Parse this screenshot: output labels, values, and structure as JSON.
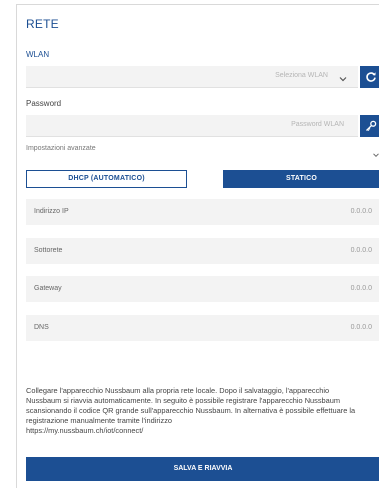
{
  "title": "RETE",
  "wlan": {
    "label": "WLAN",
    "placeholder": "Seleziona WLAN"
  },
  "password": {
    "label": "Password",
    "placeholder": "Password WLAN"
  },
  "advanced": {
    "label": "Impostazioni avanzate"
  },
  "mode": {
    "dhcp_label": "DHCP (AUTOMATICO)",
    "static_label": "STATICO",
    "selected": "STATICO"
  },
  "fields": [
    {
      "label": "Indirizzo IP",
      "value": "0.0.0.0"
    },
    {
      "label": "Sottorete",
      "value": "0.0.0.0"
    },
    {
      "label": "Gateway",
      "value": "0.0.0.0"
    },
    {
      "label": "DNS",
      "value": "0.0.0.0"
    }
  ],
  "info_lines": [
    "Collegare l'apparecchio Nussbaum alla propria rete locale. Dopo il salvataggio, l'apparecchio",
    "Nussbaum si riavvia automaticamente. In seguito è possibile registrare l'apparecchio Nussbaum",
    "scansionando il codice QR grande sull'apparecchio Nussbaum. In alternativa è possibile effettuare la",
    "registrazione manualmente tramite l'indirizzo",
    "https://my.nussbaum.ch/iot/connect/"
  ],
  "save_label": "SALVA E RIAVVIA",
  "colors": {
    "accent": "#1c4f93",
    "field_bg": "#f3f3f3"
  },
  "icons": {
    "refresh": "refresh-icon",
    "key": "key-icon",
    "wlan_dropdown": "chevron-down-icon",
    "advanced_toggle": "chevron-down-icon"
  }
}
